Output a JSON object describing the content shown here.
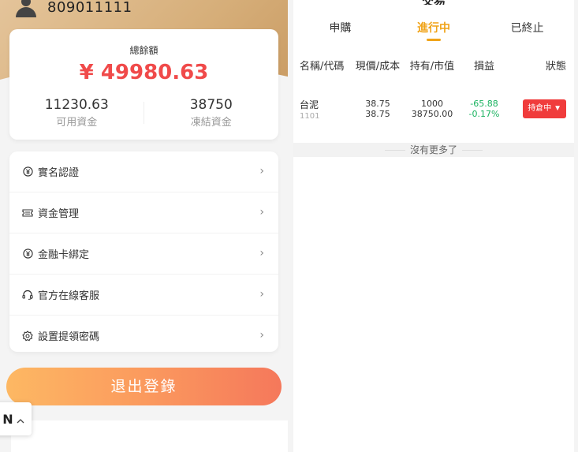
{
  "user": {
    "id": "809011111"
  },
  "balance": {
    "title": "總餘額",
    "value": "¥ 49980.63",
    "available_value": "11230.63",
    "available_label": "可用資金",
    "frozen_value": "38750",
    "frozen_label": "凍結資金"
  },
  "menu": {
    "items": [
      {
        "label": "實名認證",
        "icon": "yen-circle-icon"
      },
      {
        "label": "資金管理",
        "icon": "ticket-icon"
      },
      {
        "label": "金融卡綁定",
        "icon": "yen-circle-icon"
      },
      {
        "label": "官方在線客服",
        "icon": "headset-icon"
      },
      {
        "label": "設置提領密碼",
        "icon": "settings-gear-icon"
      }
    ]
  },
  "logout_label": "退出登錄",
  "lang": {
    "letter": "N"
  },
  "trade": {
    "title": "交易",
    "tabs": [
      {
        "label": "申購",
        "active": false
      },
      {
        "label": "進行中",
        "active": true
      },
      {
        "label": "已終止",
        "active": false
      }
    ],
    "columns": [
      "名稱/代碼",
      "現價/成本",
      "持有/市值",
      "損益",
      "狀態"
    ],
    "rows": [
      {
        "name": "台泥",
        "code": "1101",
        "price": "38.75",
        "cost": "38.75",
        "hold": "1000",
        "market_value": "38750.00",
        "pnl": "-65.88",
        "pnl_pct": "-0.17%",
        "status": "持倉中 ▼"
      }
    ],
    "no_more": "沒有更多了"
  },
  "colors": {
    "accent": "#f0a318",
    "red": "#f04a4a",
    "green": "#18b25e"
  }
}
